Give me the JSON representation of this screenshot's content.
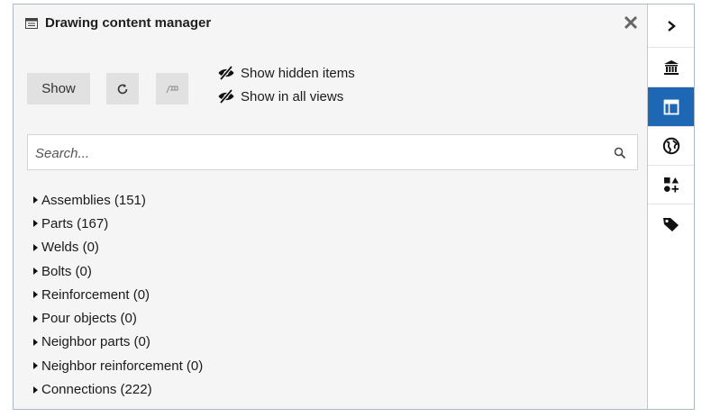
{
  "panel": {
    "title": "Drawing content manager"
  },
  "toolbar": {
    "show_label": "Show",
    "show_hidden_label": "Show hidden items",
    "show_all_views_label": "Show in all views"
  },
  "search": {
    "placeholder": "Search..."
  },
  "tree": [
    {
      "label": "Assemblies (151)"
    },
    {
      "label": "Parts (167)"
    },
    {
      "label": "Welds (0)"
    },
    {
      "label": "Bolts (0)"
    },
    {
      "label": "Reinforcement (0)"
    },
    {
      "label": "Pour objects (0)"
    },
    {
      "label": "Neighbor parts (0)"
    },
    {
      "label": "Neighbor reinforcement (0)"
    },
    {
      "label": "Connections (222)"
    }
  ],
  "sidebar": {
    "items": [
      {
        "icon": "chevron-right-icon",
        "active": false
      },
      {
        "icon": "catalog-icon",
        "active": false
      },
      {
        "icon": "drawing-content-icon",
        "active": true
      },
      {
        "icon": "globe-icon",
        "active": false
      },
      {
        "icon": "shapes-icon",
        "active": false
      },
      {
        "icon": "tag-icon",
        "active": false
      }
    ]
  },
  "colors": {
    "accent": "#1e67b5",
    "panel_bg": "#f5f5f5",
    "button_bg": "#e1e1e1"
  }
}
